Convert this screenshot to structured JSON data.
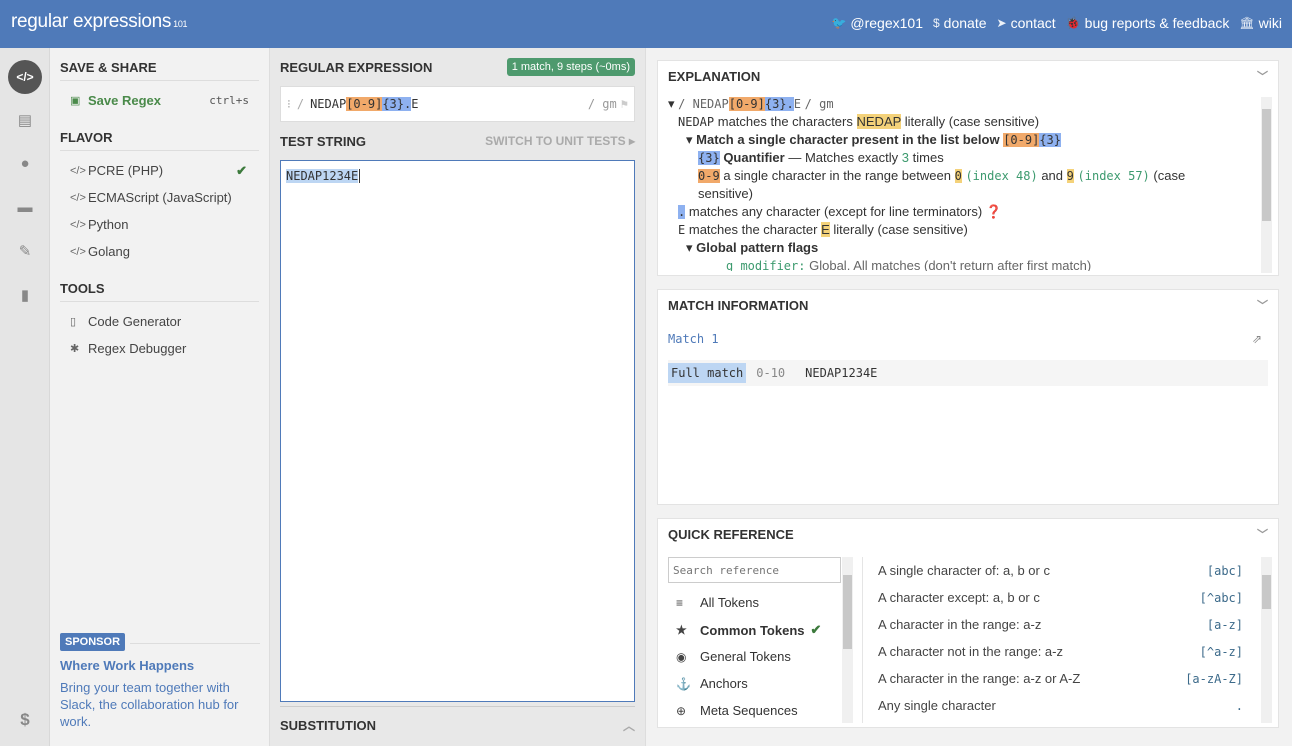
{
  "header": {
    "logo_main": "regular expressions",
    "logo_sub": "101",
    "nav": [
      {
        "icon": "twitter-icon",
        "glyph": "🐦",
        "label": "@regex101"
      },
      {
        "icon": "dollar-icon",
        "glyph": "$",
        "label": "donate"
      },
      {
        "icon": "paper-plane-icon",
        "glyph": "➤",
        "label": "contact"
      },
      {
        "icon": "bug-icon",
        "glyph": "🐞",
        "label": "bug reports & feedback"
      },
      {
        "icon": "library-icon",
        "glyph": "🏛",
        "label": "wiki"
      }
    ]
  },
  "iconbar": [
    "code-icon",
    "book-icon",
    "user-icon",
    "gamepad-icon",
    "wrench-icon",
    "chat-icon",
    "dollar-icon"
  ],
  "sidebar": {
    "save_heading": "SAVE & SHARE",
    "save_label": "Save Regex",
    "save_shortcut": "ctrl+s",
    "flavor_heading": "FLAVOR",
    "flavors": [
      "PCRE (PHP)",
      "ECMAScript (JavaScript)",
      "Python",
      "Golang"
    ],
    "selected_flavor": "PCRE (PHP)",
    "tools_heading": "TOOLS",
    "tools": [
      "Code Generator",
      "Regex Debugger"
    ],
    "sponsor_badge": "SPONSOR",
    "sponsor_title": "Where Work Happens",
    "sponsor_desc": "Bring your team together with Slack, the collaboration hub for work."
  },
  "regex": {
    "heading": "REGULAR EXPRESSION",
    "match_badge": "1 match, 9 steps (~0ms)",
    "delim": "/",
    "part_literal": "NEDAP",
    "part_class": "[0-9]",
    "part_quant": "{3}",
    "part_dot": ".",
    "part_end": "E",
    "flags": "/ gm"
  },
  "test": {
    "heading": "TEST STRING",
    "switch_label": "SWITCH TO UNIT TESTS",
    "value": "NEDAP1234E",
    "subst_heading": "SUBSTITUTION"
  },
  "explanation": {
    "heading": "EXPLANATION",
    "line0_regex_pre": "/ NEDAP",
    "line0_flags": "/ gm",
    "line1_token": "NEDAP",
    "line1_a": "matches the characters",
    "line1_b": "literally (case sensitive)",
    "line2_text": "Match a single character present in the list below",
    "line3_label": "Quantifier",
    "line3_text": "— Matches exactly",
    "line3_num": "3",
    "line3_tail": "times",
    "line4_token": "0-9",
    "line4_a": "a single character in the range between",
    "line4_from": "0",
    "line4_idx1": "(index 48)",
    "line4_and": "and",
    "line4_to": "9",
    "line4_idx2": "(index 57)",
    "line4_b": "(case",
    "line4_c": "sensitive)",
    "line5_text": "matches any character (except for line terminators)",
    "line6_token": "E",
    "line6_a": "matches the character",
    "line6_b": "literally (case sensitive)",
    "line7_text": "Global pattern flags",
    "line8_token": "g modifier:",
    "line8_text": "Global. All matches (don't return after first match)"
  },
  "match_info": {
    "heading": "MATCH INFORMATION",
    "match_title": "Match 1",
    "label": "Full match",
    "range": "0-10",
    "value": "NEDAP1234E"
  },
  "quick_ref": {
    "heading": "QUICK REFERENCE",
    "search_placeholder": "Search reference",
    "categories": [
      {
        "icon": "database-icon",
        "glyph": "≡",
        "label": "All Tokens"
      },
      {
        "icon": "star-icon",
        "glyph": "★",
        "label": "Common Tokens"
      },
      {
        "icon": "target-icon",
        "glyph": "◉",
        "label": "General Tokens"
      },
      {
        "icon": "anchor-icon",
        "glyph": "⚓",
        "label": "Anchors"
      },
      {
        "icon": "lifebuoy-icon",
        "glyph": "⊕",
        "label": "Meta Sequences"
      }
    ],
    "selected_category": "Common Tokens",
    "rows": [
      {
        "desc": "A single character of: a, b or c",
        "token": "[abc]"
      },
      {
        "desc": "A character except: a, b or c",
        "token": "[^abc]"
      },
      {
        "desc": "A character in the range: a-z",
        "token": "[a-z]"
      },
      {
        "desc": "A character not in the range: a-z",
        "token": "[^a-z]"
      },
      {
        "desc": "A character in the range: a-z or A-Z",
        "token": "[a-zA-Z]"
      },
      {
        "desc": "Any single character",
        "token": "."
      }
    ]
  }
}
